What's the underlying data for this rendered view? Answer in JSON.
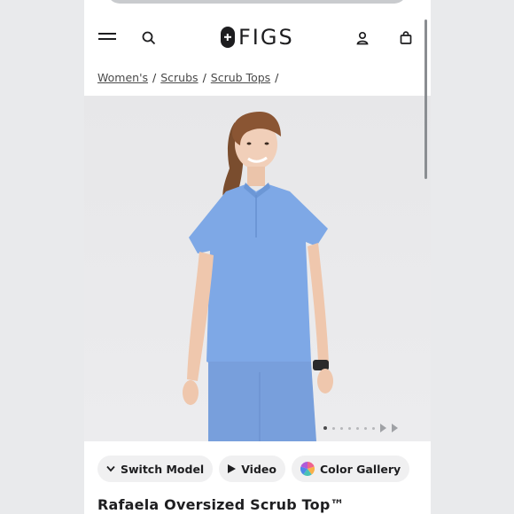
{
  "header": {
    "logo_text": "FIGS",
    "icons": [
      "menu-icon",
      "search-icon",
      "account-icon",
      "bag-icon"
    ]
  },
  "breadcrumb": {
    "items": [
      "Women's",
      "Scrubs",
      "Scrub Tops"
    ],
    "separator": "/"
  },
  "gallery": {
    "image_count": 8,
    "current_index": 1
  },
  "actions": {
    "switch_model": "Switch Model",
    "video": "Video",
    "color_gallery": "Color Gallery"
  },
  "product": {
    "title": "Rafaela Oversized Scrub Top™",
    "color": "#7ea8e6"
  },
  "colors": {
    "page_bg": "#e9eaec",
    "ink": "#1e1e20"
  }
}
